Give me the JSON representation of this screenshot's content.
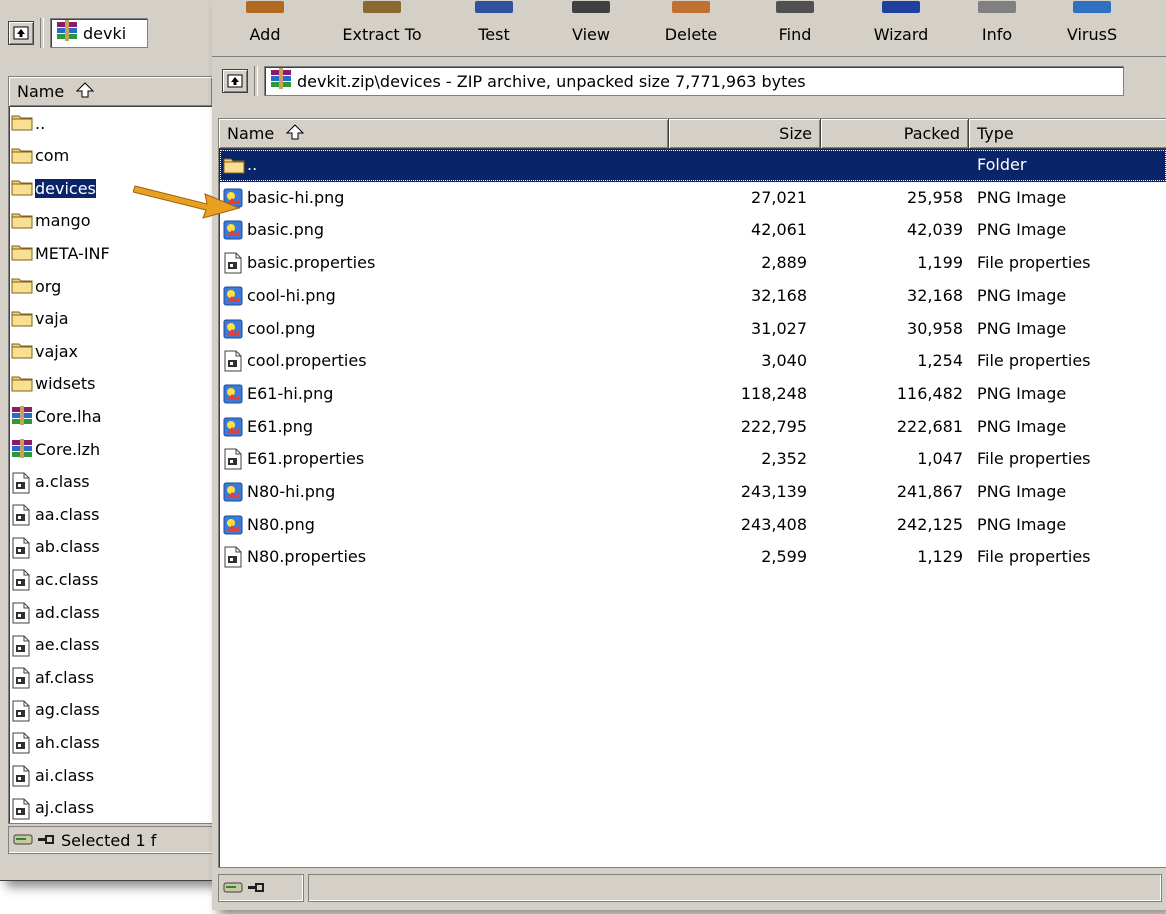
{
  "back_window": {
    "address": "devki",
    "header_name": "Name",
    "items": [
      {
        "name": "..",
        "icon": "folder-icon"
      },
      {
        "name": "com",
        "icon": "folder-icon"
      },
      {
        "name": "devices",
        "icon": "folder-icon",
        "selected": true
      },
      {
        "name": "mango",
        "icon": "folder-icon"
      },
      {
        "name": "META-INF",
        "icon": "folder-icon"
      },
      {
        "name": "org",
        "icon": "folder-icon"
      },
      {
        "name": "vaja",
        "icon": "folder-icon"
      },
      {
        "name": "vajax",
        "icon": "folder-icon"
      },
      {
        "name": "widsets",
        "icon": "folder-icon"
      },
      {
        "name": "Core.lha",
        "icon": "archive-icon"
      },
      {
        "name": "Core.lzh",
        "icon": "archive-icon"
      },
      {
        "name": "a.class",
        "icon": "class-file-icon"
      },
      {
        "name": "aa.class",
        "icon": "class-file-icon"
      },
      {
        "name": "ab.class",
        "icon": "class-file-icon"
      },
      {
        "name": "ac.class",
        "icon": "class-file-icon"
      },
      {
        "name": "ad.class",
        "icon": "class-file-icon"
      },
      {
        "name": "ae.class",
        "icon": "class-file-icon"
      },
      {
        "name": "af.class",
        "icon": "class-file-icon"
      },
      {
        "name": "ag.class",
        "icon": "class-file-icon"
      },
      {
        "name": "ah.class",
        "icon": "class-file-icon"
      },
      {
        "name": "ai.class",
        "icon": "class-file-icon"
      },
      {
        "name": "aj.class",
        "icon": "class-file-icon"
      }
    ],
    "status": "Selected 1 f"
  },
  "front_window": {
    "toolbar": [
      {
        "label": "Add",
        "icon": "add-icon"
      },
      {
        "label": "Extract To",
        "icon": "extract-icon"
      },
      {
        "label": "Test",
        "icon": "test-icon"
      },
      {
        "label": "View",
        "icon": "view-icon"
      },
      {
        "label": "Delete",
        "icon": "delete-icon"
      },
      {
        "label": "Find",
        "icon": "find-icon"
      },
      {
        "label": "Wizard",
        "icon": "wizard-icon"
      },
      {
        "label": "Info",
        "icon": "info-icon"
      },
      {
        "label": "VirusS",
        "icon": "virus-scan-icon"
      }
    ],
    "address": "devkit.zip\\devices - ZIP archive, unpacked size 7,771,963 bytes",
    "columns": {
      "name": "Name",
      "size": "Size",
      "packed": "Packed",
      "type": "Type"
    },
    "files": [
      {
        "name": "..",
        "size": "",
        "packed": "",
        "type": "Folder",
        "icon": "folder-icon",
        "selected": true
      },
      {
        "name": "basic-hi.png",
        "size": "27,021",
        "packed": "25,958",
        "type": "PNG Image",
        "icon": "png-icon"
      },
      {
        "name": "basic.png",
        "size": "42,061",
        "packed": "42,039",
        "type": "PNG Image",
        "icon": "png-icon"
      },
      {
        "name": "basic.properties",
        "size": "2,889",
        "packed": "1,199",
        "type": "File properties",
        "icon": "properties-icon"
      },
      {
        "name": "cool-hi.png",
        "size": "32,168",
        "packed": "32,168",
        "type": "PNG Image",
        "icon": "png-icon"
      },
      {
        "name": "cool.png",
        "size": "31,027",
        "packed": "30,958",
        "type": "PNG Image",
        "icon": "png-icon"
      },
      {
        "name": "cool.properties",
        "size": "3,040",
        "packed": "1,254",
        "type": "File properties",
        "icon": "properties-icon"
      },
      {
        "name": "E61-hi.png",
        "size": "118,248",
        "packed": "116,482",
        "type": "PNG Image",
        "icon": "png-icon"
      },
      {
        "name": "E61.png",
        "size": "222,795",
        "packed": "222,681",
        "type": "PNG Image",
        "icon": "png-icon"
      },
      {
        "name": "E61.properties",
        "size": "2,352",
        "packed": "1,047",
        "type": "File properties",
        "icon": "properties-icon"
      },
      {
        "name": "N80-hi.png",
        "size": "243,139",
        "packed": "241,867",
        "type": "PNG Image",
        "icon": "png-icon"
      },
      {
        "name": "N80.png",
        "size": "243,408",
        "packed": "242,125",
        "type": "PNG Image",
        "icon": "png-icon"
      },
      {
        "name": "N80.properties",
        "size": "2,599",
        "packed": "1,129",
        "type": "File properties",
        "icon": "properties-icon"
      }
    ],
    "status": ""
  },
  "colors": {
    "selection": "#0a246a",
    "window_bg": "#d4d0c8",
    "arrow": "#e8a020"
  }
}
